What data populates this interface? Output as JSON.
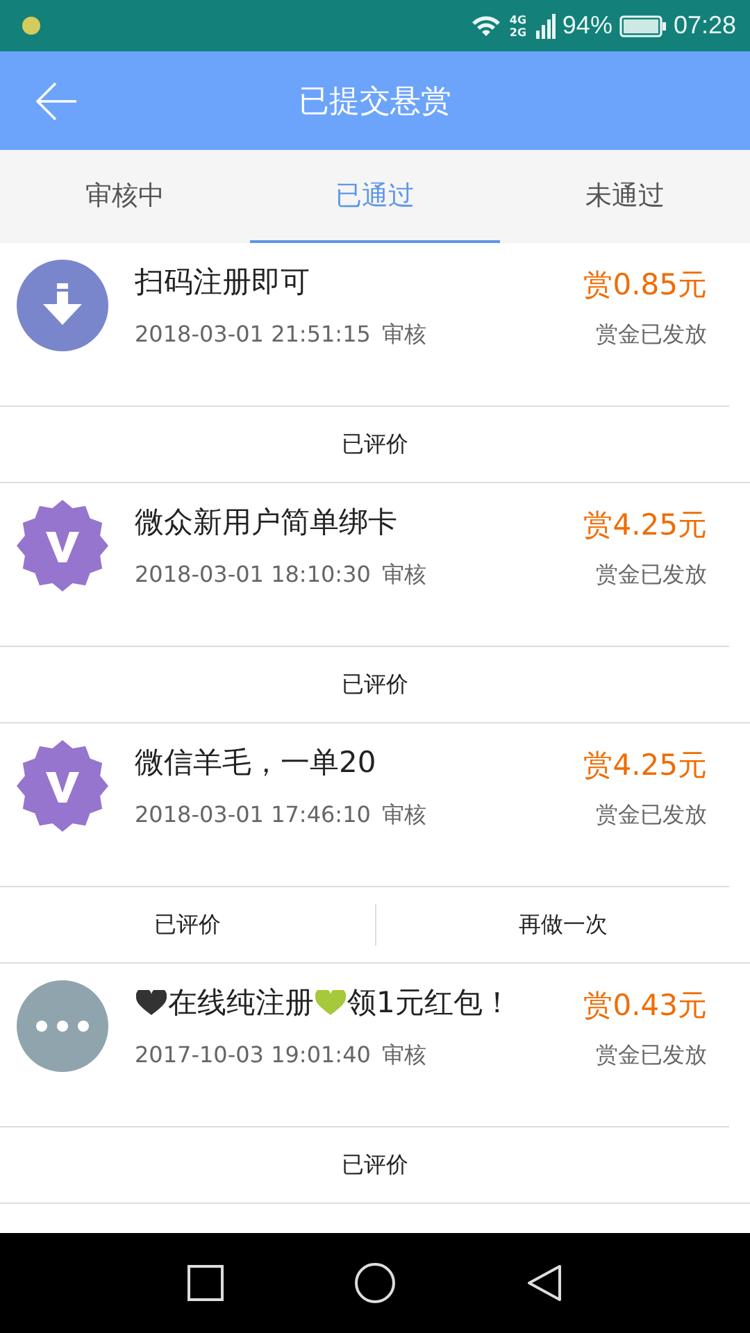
{
  "status_bar": {
    "battery": "94%",
    "time": "07:28",
    "network": "4G 2G"
  },
  "header": {
    "title": "已提交悬赏"
  },
  "tabs": [
    {
      "label": "审核中",
      "selected": false
    },
    {
      "label": "已通过",
      "selected": true
    },
    {
      "label": "未通过",
      "selected": false
    }
  ],
  "tasks": [
    {
      "kind": "download",
      "title_parts": [
        {
          "text": "扫码注册即可"
        }
      ],
      "reward": "赏0.85元",
      "time": "2018-03-01 21:51:15",
      "stage": "审核",
      "status": "赏金已发放",
      "actions": [
        "已评价"
      ]
    },
    {
      "kind": "badge",
      "title_parts": [
        {
          "text": "微众新用户简单绑卡"
        }
      ],
      "reward": "赏4.25元",
      "time": "2018-03-01 18:10:30",
      "stage": "审核",
      "status": "赏金已发放",
      "actions": [
        "已评价"
      ]
    },
    {
      "kind": "badge",
      "title_parts": [
        {
          "text": "微信羊毛，一单20"
        }
      ],
      "reward": "赏4.25元",
      "time": "2018-03-01 17:46:10",
      "stage": "审核",
      "status": "赏金已发放",
      "actions": [
        "已评价",
        "再做一次"
      ]
    },
    {
      "kind": "more",
      "title_parts": [
        {
          "kind": "heart",
          "color": "#333333"
        },
        {
          "text": "在线纯注册"
        },
        {
          "kind": "heart",
          "color": "#a5c93a"
        },
        {
          "text": "领1元红包！"
        }
      ],
      "reward": "赏0.43元",
      "time": "2017-10-03 19:01:40",
      "stage": "审核",
      "status": "赏金已发放",
      "actions": [
        "已评价"
      ]
    }
  ]
}
